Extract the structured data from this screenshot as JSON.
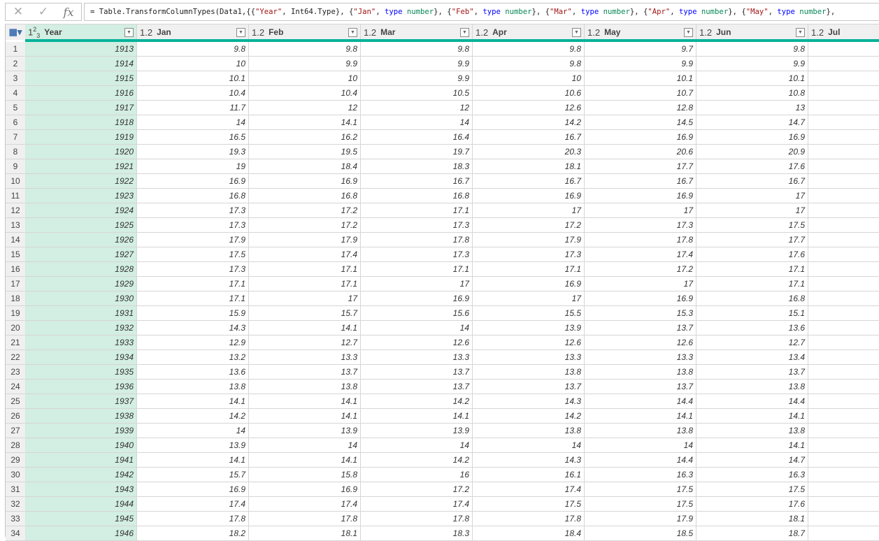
{
  "formula_bar": {
    "cancel_icon": "close-icon",
    "commit_icon": "check-icon",
    "fx_label": "fx",
    "formula_tokens": [
      {
        "t": "plain",
        "v": "= Table.TransformColumnTypes(Data1,{{"
      },
      {
        "t": "str",
        "v": "\"Year\""
      },
      {
        "t": "plain",
        "v": ", Int64.Type}, {"
      },
      {
        "t": "str",
        "v": "\"Jan\""
      },
      {
        "t": "plain",
        "v": ", "
      },
      {
        "t": "kw",
        "v": "type"
      },
      {
        "t": "num",
        "v": " number"
      },
      {
        "t": "plain",
        "v": "}, {"
      },
      {
        "t": "str",
        "v": "\"Feb\""
      },
      {
        "t": "plain",
        "v": ", "
      },
      {
        "t": "kw",
        "v": "type"
      },
      {
        "t": "num",
        "v": " number"
      },
      {
        "t": "plain",
        "v": "}, {"
      },
      {
        "t": "str",
        "v": "\"Mar\""
      },
      {
        "t": "plain",
        "v": ", "
      },
      {
        "t": "kw",
        "v": "type"
      },
      {
        "t": "num",
        "v": " number"
      },
      {
        "t": "plain",
        "v": "}, {"
      },
      {
        "t": "str",
        "v": "\"Apr\""
      },
      {
        "t": "plain",
        "v": ", "
      },
      {
        "t": "kw",
        "v": "type"
      },
      {
        "t": "num",
        "v": " number"
      },
      {
        "t": "plain",
        "v": "}, {"
      },
      {
        "t": "str",
        "v": "\"May\""
      },
      {
        "t": "plain",
        "v": ", "
      },
      {
        "t": "kw",
        "v": "type"
      },
      {
        "t": "num",
        "v": " number"
      },
      {
        "t": "plain",
        "v": "},"
      }
    ]
  },
  "grid": {
    "table_menu_icon": "table-icon",
    "columns": [
      {
        "type_label": "123",
        "name": "Year",
        "selected": true
      },
      {
        "type_label": "1.2",
        "name": "Jan"
      },
      {
        "type_label": "1.2",
        "name": "Feb"
      },
      {
        "type_label": "1.2",
        "name": "Mar"
      },
      {
        "type_label": "1.2",
        "name": "Apr"
      },
      {
        "type_label": "1.2",
        "name": "May"
      },
      {
        "type_label": "1.2",
        "name": "Jun"
      },
      {
        "type_label": "1.2",
        "name": "Jul"
      }
    ],
    "colors": {
      "selected_column": "#d3eee2",
      "quality_bar": "#05b29a"
    },
    "rows": [
      [
        "1913",
        "9.8",
        "9.8",
        "9.8",
        "9.8",
        "9.7",
        "9.8",
        ""
      ],
      [
        "1914",
        "10",
        "9.9",
        "9.9",
        "9.8",
        "9.9",
        "9.9",
        ""
      ],
      [
        "1915",
        "10.1",
        "10",
        "9.9",
        "10",
        "10.1",
        "10.1",
        ""
      ],
      [
        "1916",
        "10.4",
        "10.4",
        "10.5",
        "10.6",
        "10.7",
        "10.8",
        ""
      ],
      [
        "1917",
        "11.7",
        "12",
        "12",
        "12.6",
        "12.8",
        "13",
        ""
      ],
      [
        "1918",
        "14",
        "14.1",
        "14",
        "14.2",
        "14.5",
        "14.7",
        ""
      ],
      [
        "1919",
        "16.5",
        "16.2",
        "16.4",
        "16.7",
        "16.9",
        "16.9",
        ""
      ],
      [
        "1920",
        "19.3",
        "19.5",
        "19.7",
        "20.3",
        "20.6",
        "20.9",
        ""
      ],
      [
        "1921",
        "19",
        "18.4",
        "18.3",
        "18.1",
        "17.7",
        "17.6",
        ""
      ],
      [
        "1922",
        "16.9",
        "16.9",
        "16.7",
        "16.7",
        "16.7",
        "16.7",
        ""
      ],
      [
        "1923",
        "16.8",
        "16.8",
        "16.8",
        "16.9",
        "16.9",
        "17",
        ""
      ],
      [
        "1924",
        "17.3",
        "17.2",
        "17.1",
        "17",
        "17",
        "17",
        ""
      ],
      [
        "1925",
        "17.3",
        "17.2",
        "17.3",
        "17.2",
        "17.3",
        "17.5",
        ""
      ],
      [
        "1926",
        "17.9",
        "17.9",
        "17.8",
        "17.9",
        "17.8",
        "17.7",
        ""
      ],
      [
        "1927",
        "17.5",
        "17.4",
        "17.3",
        "17.3",
        "17.4",
        "17.6",
        ""
      ],
      [
        "1928",
        "17.3",
        "17.1",
        "17.1",
        "17.1",
        "17.2",
        "17.1",
        ""
      ],
      [
        "1929",
        "17.1",
        "17.1",
        "17",
        "16.9",
        "17",
        "17.1",
        ""
      ],
      [
        "1930",
        "17.1",
        "17",
        "16.9",
        "17",
        "16.9",
        "16.8",
        ""
      ],
      [
        "1931",
        "15.9",
        "15.7",
        "15.6",
        "15.5",
        "15.3",
        "15.1",
        ""
      ],
      [
        "1932",
        "14.3",
        "14.1",
        "14",
        "13.9",
        "13.7",
        "13.6",
        ""
      ],
      [
        "1933",
        "12.9",
        "12.7",
        "12.6",
        "12.6",
        "12.6",
        "12.7",
        ""
      ],
      [
        "1934",
        "13.2",
        "13.3",
        "13.3",
        "13.3",
        "13.3",
        "13.4",
        ""
      ],
      [
        "1935",
        "13.6",
        "13.7",
        "13.7",
        "13.8",
        "13.8",
        "13.7",
        ""
      ],
      [
        "1936",
        "13.8",
        "13.8",
        "13.7",
        "13.7",
        "13.7",
        "13.8",
        ""
      ],
      [
        "1937",
        "14.1",
        "14.1",
        "14.2",
        "14.3",
        "14.4",
        "14.4",
        ""
      ],
      [
        "1938",
        "14.2",
        "14.1",
        "14.1",
        "14.2",
        "14.1",
        "14.1",
        ""
      ],
      [
        "1939",
        "14",
        "13.9",
        "13.9",
        "13.8",
        "13.8",
        "13.8",
        ""
      ],
      [
        "1940",
        "13.9",
        "14",
        "14",
        "14",
        "14",
        "14.1",
        ""
      ],
      [
        "1941",
        "14.1",
        "14.1",
        "14.2",
        "14.3",
        "14.4",
        "14.7",
        ""
      ],
      [
        "1942",
        "15.7",
        "15.8",
        "16",
        "16.1",
        "16.3",
        "16.3",
        ""
      ],
      [
        "1943",
        "16.9",
        "16.9",
        "17.2",
        "17.4",
        "17.5",
        "17.5",
        ""
      ],
      [
        "1944",
        "17.4",
        "17.4",
        "17.4",
        "17.5",
        "17.5",
        "17.6",
        ""
      ],
      [
        "1945",
        "17.8",
        "17.8",
        "17.8",
        "17.8",
        "17.9",
        "18.1",
        ""
      ],
      [
        "1946",
        "18.2",
        "18.1",
        "18.3",
        "18.4",
        "18.5",
        "18.7",
        ""
      ]
    ]
  }
}
